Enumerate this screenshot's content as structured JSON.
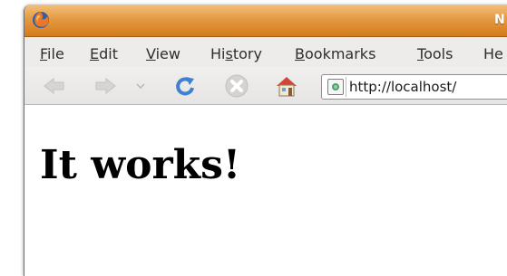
{
  "window": {
    "title": "N"
  },
  "menu": {
    "items": [
      {
        "label": "File",
        "underline": "F",
        "rest": "ile"
      },
      {
        "label": "Edit",
        "underline": "E",
        "rest": "dit"
      },
      {
        "label": "View",
        "underline": "V",
        "rest": "iew"
      },
      {
        "label": "History",
        "pre": "Hi",
        "underline": "s",
        "rest": "tory"
      },
      {
        "label": "Bookmarks",
        "underline": "B",
        "rest": "ookmarks"
      },
      {
        "label": "Tools",
        "underline": "T",
        "rest": "ools"
      },
      {
        "label": "He",
        "pre": "",
        "underline": "",
        "rest": "He"
      }
    ]
  },
  "toolbar": {
    "back_icon": "back-arrow-icon",
    "forward_icon": "forward-arrow-icon",
    "history_dropdown_icon": "chevron-down-icon",
    "reload_icon": "reload-icon",
    "stop_icon": "stop-icon",
    "home_icon": "home-icon"
  },
  "address_bar": {
    "url": "http://localhost/"
  },
  "page": {
    "heading": "It works!"
  },
  "colors": {
    "titlebar": "#e59a42",
    "menubar": "#edeceb",
    "reload": "#3f7fd6",
    "home_roof": "#d0463a"
  }
}
